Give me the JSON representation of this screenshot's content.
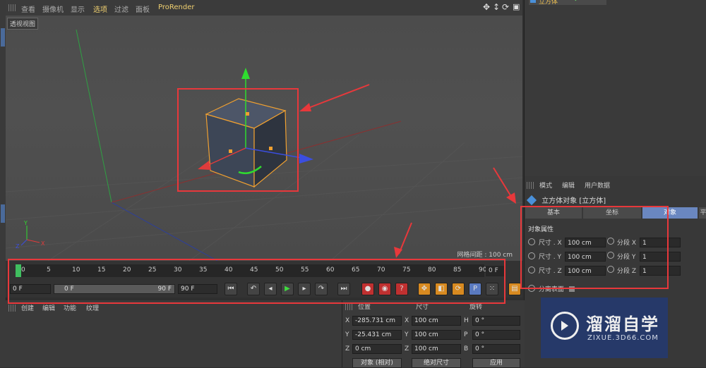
{
  "viewport_menu": {
    "items": [
      "查看",
      "摄像机",
      "显示",
      "选项",
      "过滤",
      "面板",
      "ProRender"
    ]
  },
  "viewport": {
    "label": "透视视图",
    "grid_spacing": "网格间距 : 100 cm"
  },
  "object_manager": {
    "item": "立方体"
  },
  "attributes": {
    "menu": [
      "模式",
      "编辑",
      "用户数据"
    ],
    "title": "立方体对象 [立方体]",
    "tabs": [
      "基本",
      "坐标",
      "对象",
      "平"
    ],
    "section": "对象属性",
    "rows": [
      {
        "label": "尺寸 . X",
        "value": "100 cm",
        "seg_label": "分段 X",
        "seg_value": "1"
      },
      {
        "label": "尺寸 . Y",
        "value": "100 cm",
        "seg_label": "分段 Y",
        "seg_value": "1"
      },
      {
        "label": "尺寸 . Z",
        "value": "100 cm",
        "seg_label": "分段 Z",
        "seg_value": "1"
      }
    ],
    "separate_surfaces": "分离表面"
  },
  "timeline": {
    "ticks": [
      "0",
      "5",
      "10",
      "15",
      "20",
      "25",
      "30",
      "35",
      "40",
      "45",
      "50",
      "55",
      "60",
      "65",
      "70",
      "75",
      "80",
      "85",
      "90"
    ],
    "current_frame": "0 F",
    "start_frame": "0 F",
    "range_start": "0 F",
    "range_end": "90 F",
    "end_frame": "90 F"
  },
  "material_menu": [
    "创建",
    "编辑",
    "功能",
    "纹理"
  ],
  "coordinates": {
    "headers": [
      "位置",
      "尺寸",
      "旋转"
    ],
    "rows": [
      {
        "axis": "X",
        "pos": "-285.731 cm",
        "size_axis": "X",
        "size": "100 cm",
        "rot_axis": "H",
        "rot": "0 °"
      },
      {
        "axis": "Y",
        "pos": "-25.431 cm",
        "size_axis": "Y",
        "size": "100 cm",
        "rot_axis": "P",
        "rot": "0 °"
      },
      {
        "axis": "Z",
        "pos": "0 cm",
        "size_axis": "Z",
        "size": "100 cm",
        "rot_axis": "B",
        "rot": "0 °"
      }
    ],
    "mode_select": "对象 (相对)",
    "size_select": "绝对尺寸",
    "apply": "应用"
  },
  "watermark": {
    "title": "溜溜自学",
    "sub": "ZIXUE.3D66.COM"
  },
  "colors": {
    "highlight": "#e8383b",
    "accent": "#f0d070",
    "cube_face": "#3d4656"
  }
}
